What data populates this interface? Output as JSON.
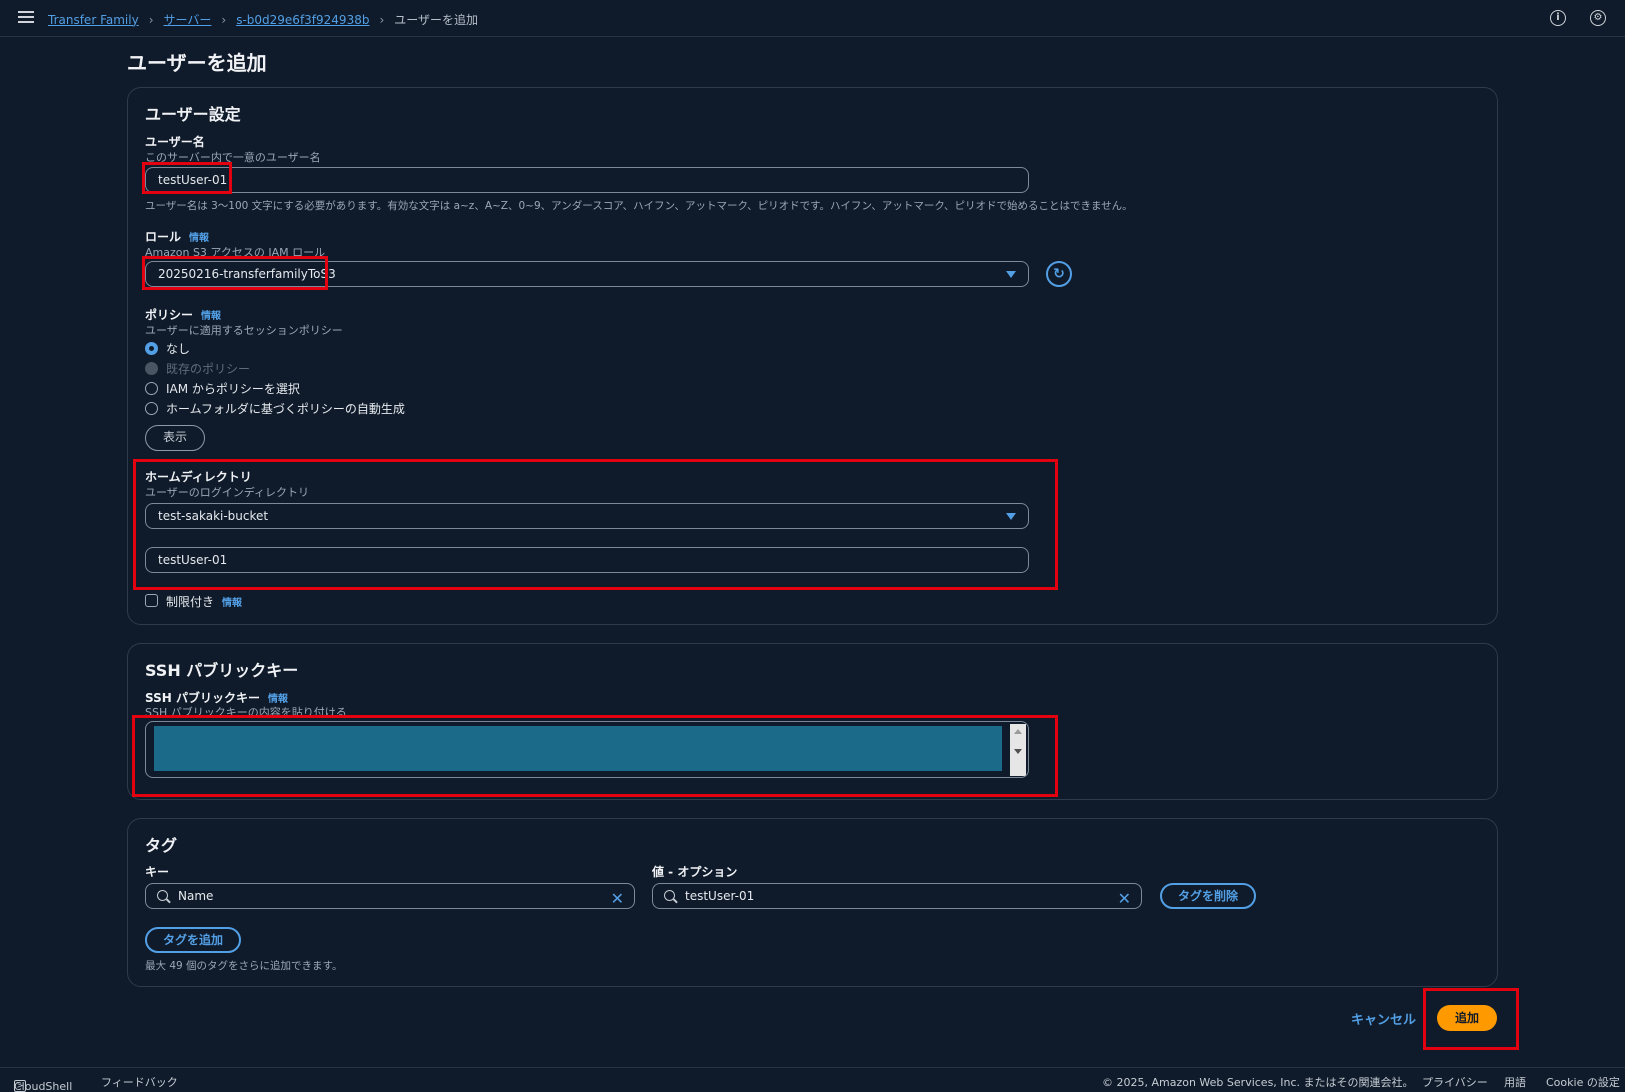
{
  "breadcrumb": {
    "items": [
      "Transfer Family",
      "サーバー",
      "s-b0d29e6f3f924938b"
    ],
    "current": "ユーザーを追加"
  },
  "page": {
    "title": "ユーザーを追加"
  },
  "user_settings": {
    "title": "ユーザー設定",
    "username": {
      "label": "ユーザー名",
      "description": "このサーバー内で一意のユーザー名",
      "value": "testUser-01",
      "hint": "ユーザー名は 3～100 文字にする必要があります。有効な文字は a~z、A~Z、0~9、アンダースコア、ハイフン、アットマーク、ピリオドです。ハイフン、アットマーク、ピリオドで始めることはできません。"
    },
    "role": {
      "label": "ロール",
      "info": "情報",
      "description": "Amazon S3 アクセスの IAM ロール",
      "value": "20250216-transferfamilyToS3"
    },
    "policy": {
      "label": "ポリシー",
      "info": "情報",
      "description": "ユーザーに適用するセッションポリシー",
      "options": [
        "なし",
        "既存のポリシー",
        "IAM からポリシーを選択",
        "ホームフォルダに基づくポリシーの自動生成"
      ],
      "selected": "なし",
      "show_button": "表示"
    },
    "home_directory": {
      "label": "ホームディレクトリ",
      "description": "ユーザーのログインディレクトリ",
      "bucket": "test-sakaki-bucket",
      "path": "testUser-01"
    },
    "restricted": {
      "label": "制限付き",
      "info": "情報"
    }
  },
  "ssh": {
    "title": "SSH パブリックキー",
    "label": "SSH パブリックキー",
    "info": "情報",
    "description": "SSH パブリックキーの内容を貼り付ける"
  },
  "tags": {
    "title": "タグ",
    "key_label": "キー",
    "value_label": "値 - オプション",
    "key_value": "Name",
    "value_value": "testUser-01",
    "remove_button": "タグを削除",
    "add_button": "タグを追加",
    "limit_text": "最大 49 個のタグをさらに追加できます。"
  },
  "actions": {
    "cancel": "キャンセル",
    "submit": "追加"
  },
  "footer": {
    "cloudshell": "CloudShell",
    "feedback": "フィードバック",
    "copyright": "© 2025, Amazon Web Services, Inc. またはその関連会社。",
    "privacy": "プライバシー",
    "terms": "用語",
    "cookie": "Cookie の設定"
  },
  "colors": {
    "accent": "#539fe5",
    "primary": "#ff9900",
    "highlight": "#e3000f",
    "background": "#0f1b2a"
  }
}
